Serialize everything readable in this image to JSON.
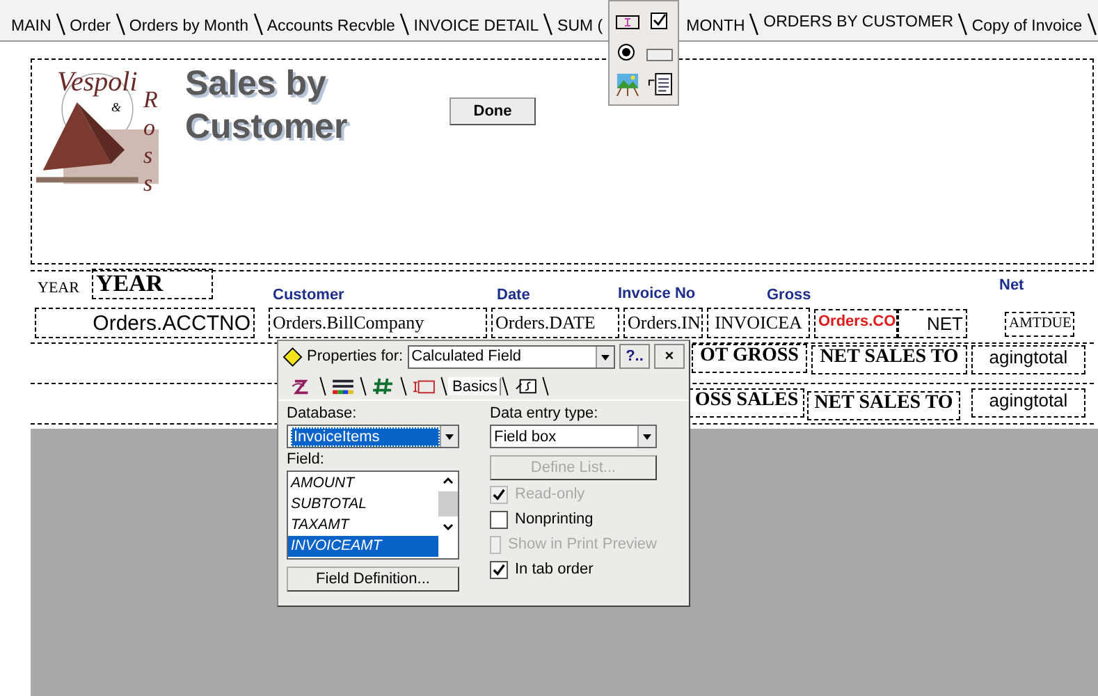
{
  "layout_tabs": [
    {
      "label": "MAIN",
      "selected": false
    },
    {
      "label": "Order",
      "selected": false
    },
    {
      "label": "Orders by Month",
      "selected": false
    },
    {
      "label": "Accounts Recvble",
      "selected": false
    },
    {
      "label": "INVOICE DETAIL",
      "selected": false
    },
    {
      "label": "SUM (",
      "label_after_cover": "MONTH",
      "selected": false
    },
    {
      "label": "ORDERS BY CUSTOMER",
      "selected": true
    },
    {
      "label": "Copy of Invoice",
      "selected": false
    }
  ],
  "header_band": {
    "logo_text": [
      "Vespoli",
      "&",
      "Ross"
    ],
    "title_lines": [
      "Sales by",
      "Customer"
    ],
    "done_button": "Done"
  },
  "year": {
    "label": "YEAR",
    "field": "YEAR"
  },
  "column_headers": [
    "Customer",
    "Date",
    "Invoice No",
    "Gross",
    "Net"
  ],
  "detail_fields": [
    {
      "text": "Orders.ACCTNO",
      "color": "#000000"
    },
    {
      "text": "Orders.BillCompany",
      "color": "#000000"
    },
    {
      "text": "Orders.DATE",
      "color": "#000000"
    },
    {
      "text": "Orders.IN",
      "color": "#000000"
    },
    {
      "text": "INVOICEA",
      "color": "#000000"
    },
    {
      "text": "Orders.CO",
      "color": "#e01818"
    },
    {
      "text": "NET",
      "color": "#000000"
    },
    {
      "text": "AMTDUE",
      "color": "#000000"
    }
  ],
  "total_rows": [
    [
      "OT GROSS",
      "NET SALES TO",
      "agingtotal"
    ],
    [
      "OSS SALES",
      "NET SALES TO",
      "agingtotal"
    ]
  ],
  "properties_dialog": {
    "label": "Properties for:",
    "object": "Calculated Field",
    "help_button": "?..",
    "close_button": "×",
    "tabs": [
      {
        "kind": "font",
        "selected": false
      },
      {
        "kind": "color",
        "selected": false
      },
      {
        "kind": "number",
        "selected": false
      },
      {
        "kind": "frame",
        "selected": false
      },
      {
        "kind": "text",
        "label": "Basics",
        "selected": true
      },
      {
        "kind": "script",
        "selected": false
      }
    ],
    "database_label": "Database:",
    "database": "InvoiceItems",
    "field_label": "Field:",
    "fields": [
      {
        "name": "AMOUNT",
        "selected": false
      },
      {
        "name": "SUBTOTAL",
        "selected": false
      },
      {
        "name": "TAXAMT",
        "selected": false
      },
      {
        "name": "INVOICEAMT",
        "selected": true
      }
    ],
    "field_definition_button": "Field Definition...",
    "entry_type_label": "Data entry type:",
    "entry_type": "Field box",
    "define_list_button": "Define List...",
    "define_list_disabled": true,
    "options": [
      {
        "label": "Read-only",
        "checked": true,
        "disabled": true
      },
      {
        "label": "Nonprinting",
        "checked": false,
        "disabled": false
      },
      {
        "label": "Show in Print Preview",
        "checked": false,
        "disabled": true
      },
      {
        "label": "In tab order",
        "checked": true,
        "disabled": false
      }
    ]
  }
}
